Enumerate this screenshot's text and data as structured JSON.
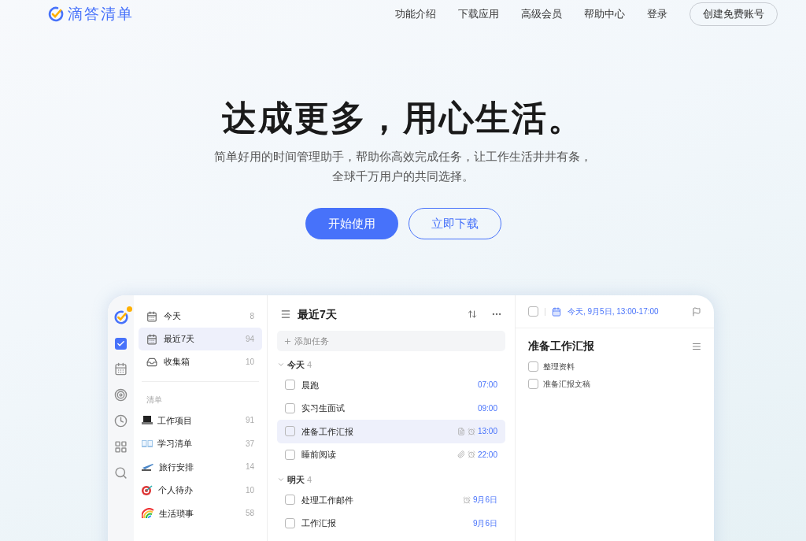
{
  "nav": {
    "logo": "滴答清单",
    "links": [
      "功能介绍",
      "下载应用",
      "高级会员",
      "帮助中心",
      "登录"
    ],
    "signup": "创建免费账号"
  },
  "hero": {
    "title": "达成更多，用心生活。",
    "subtitle": [
      "简单好用的时间管理助手，帮助你高效完成任务，让工作生活井井有条，",
      "全球千万用户的共同选择。"
    ],
    "primary": "开始使用",
    "secondary": "立即下载"
  },
  "app": {
    "rail": [
      {
        "kind": "tasks",
        "selected": true
      },
      {
        "kind": "calendar",
        "selected": false
      },
      {
        "kind": "focus",
        "selected": false
      },
      {
        "kind": "clock",
        "selected": false
      },
      {
        "kind": "apps",
        "selected": false
      },
      {
        "kind": "search",
        "selected": false
      }
    ],
    "smart_lists": [
      {
        "kind": "today",
        "label": "今天",
        "count": "8",
        "selected": false
      },
      {
        "kind": "week",
        "label": "最近7天",
        "count": "94",
        "selected": true
      },
      {
        "kind": "inbox",
        "label": "收集箱",
        "count": "10",
        "selected": false
      }
    ],
    "lists_heading": "清单",
    "lists": [
      {
        "kind": "laptop",
        "label": "工作项目",
        "count": "91"
      },
      {
        "kind": "book",
        "label": "学习清单",
        "count": "37"
      },
      {
        "kind": "plane",
        "label": "旅行安排",
        "count": "14"
      },
      {
        "kind": "target",
        "label": "个人待办",
        "count": "10"
      },
      {
        "kind": "rainbow",
        "label": "生活琐事",
        "count": "58"
      }
    ],
    "tasks_title": "最近7天",
    "add_placeholder": "添加任务",
    "groups": [
      {
        "label": "今天",
        "count": "4",
        "expanded": true,
        "tasks": [
          {
            "title": "晨跑",
            "time": "07:00",
            "selected": false,
            "checked": false,
            "has_note": false,
            "has_attachment": false,
            "has_reminder": false
          },
          {
            "title": "实习生面试",
            "time": "09:00",
            "selected": false,
            "checked": false,
            "has_note": false,
            "has_attachment": false,
            "has_reminder": false
          },
          {
            "title": "准备工作汇报",
            "time": "13:00",
            "selected": true,
            "checked": false,
            "has_note": true,
            "has_attachment": false,
            "has_reminder": true
          },
          {
            "title": "睡前阅读",
            "time": "22:00",
            "selected": false,
            "checked": false,
            "has_note": false,
            "has_attachment": true,
            "has_reminder": true
          }
        ]
      },
      {
        "label": "明天",
        "count": "4",
        "expanded": true,
        "tasks": [
          {
            "title": "处理工作邮件",
            "time": "9月6日",
            "selected": false,
            "checked": false,
            "has_note": false,
            "has_attachment": false,
            "has_reminder": true
          },
          {
            "title": "工作汇报",
            "time": "9月6日",
            "selected": false,
            "checked": false,
            "has_note": false,
            "has_attachment": false,
            "has_reminder": false
          }
        ]
      }
    ],
    "detail": {
      "checked": false,
      "date": "今天, 9月5日, 13:00-17:00",
      "title": "准备工作汇报",
      "subtasks": [
        {
          "text": "整理资料",
          "checked": false
        },
        {
          "text": "准备汇报文稿",
          "checked": false
        }
      ]
    }
  }
}
